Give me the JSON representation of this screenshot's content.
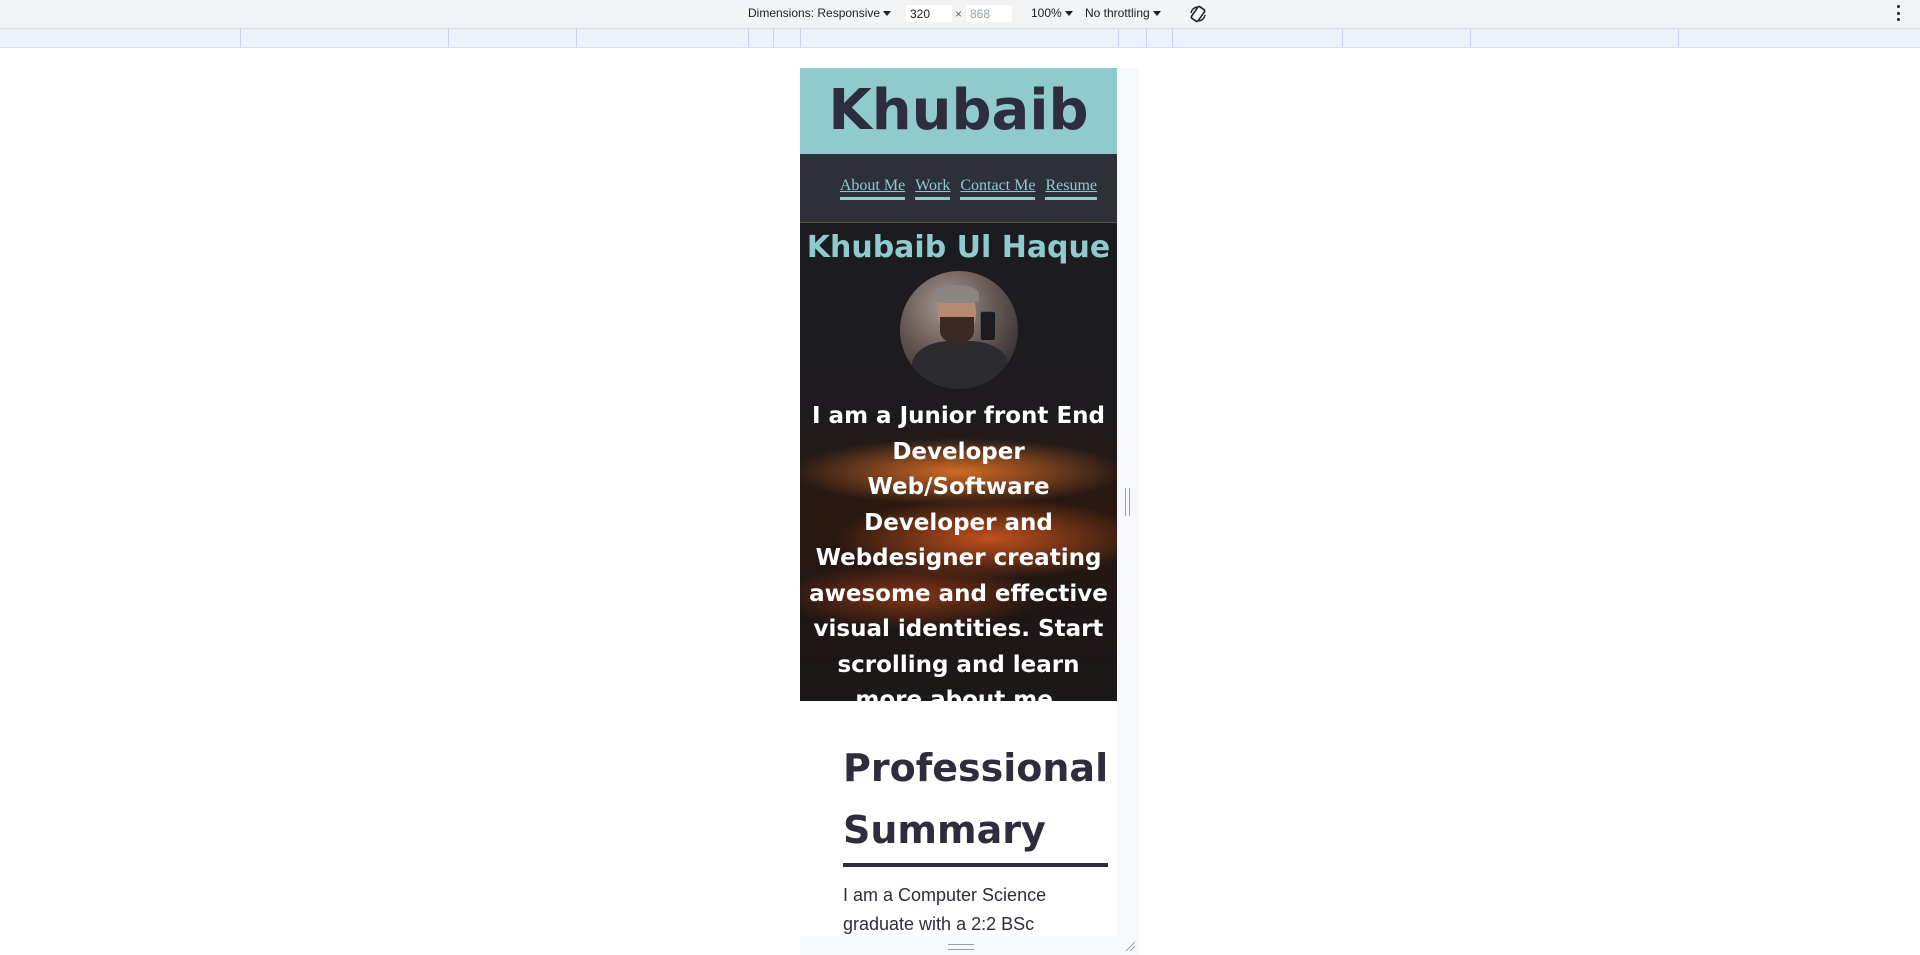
{
  "devtools": {
    "dimensions_label": "Dimensions: Responsive",
    "width_value": "320",
    "height_placeholder": "868",
    "times": "×",
    "zoom": "100%",
    "throttling": "No throttling"
  },
  "site": {
    "brand": "Khubaib",
    "nav": [
      "About Me",
      "Work",
      "Contact Me",
      "Resume"
    ],
    "hero": {
      "name": "Khubaib Ul Haque",
      "intro": "I am a Junior front End Developer Web/Software Developer and Webdesigner creating awesome and effective visual identities. Start scrolling and learn more about me."
    },
    "summary": {
      "title": "Professional Summary",
      "body": "I am a Computer Science graduate with a 2:2 BSc"
    }
  }
}
